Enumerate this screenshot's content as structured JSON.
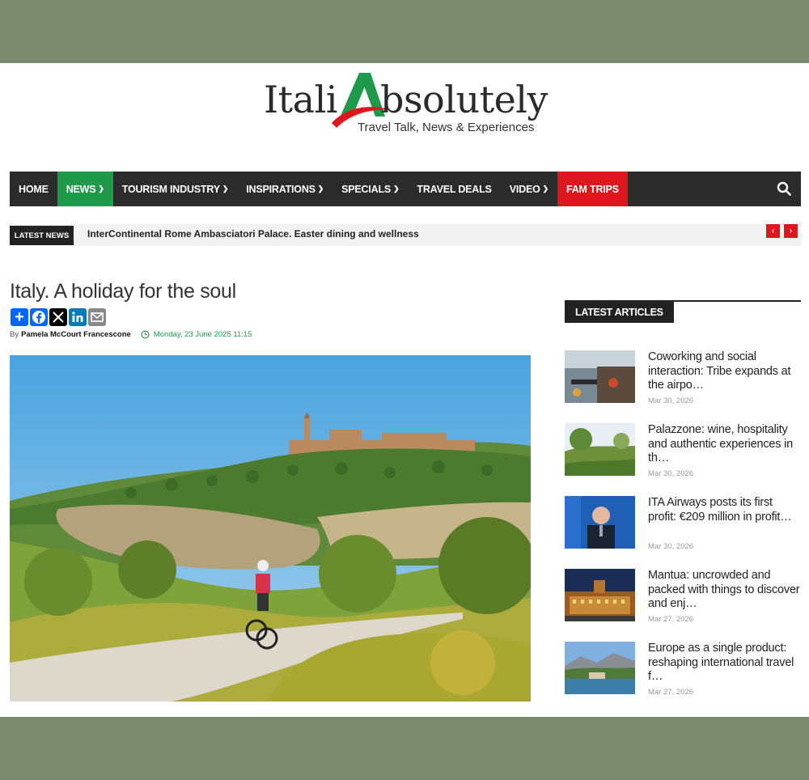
{
  "brand": {
    "logo_part1": "Itali",
    "logo_part2": "bsolutely",
    "tagline": "Travel Talk, News & Experiences",
    "colors": {
      "green": "#1f9a4b",
      "red": "#e0161f",
      "dark": "#2b2b2b"
    }
  },
  "nav": {
    "items": [
      {
        "label": "HOME",
        "has_dropdown": false
      },
      {
        "label": "NEWS",
        "has_dropdown": true,
        "active": true
      },
      {
        "label": "TOURISM INDUSTRY",
        "has_dropdown": true
      },
      {
        "label": "INSPIRATIONS",
        "has_dropdown": true
      },
      {
        "label": "SPECIALS",
        "has_dropdown": true
      },
      {
        "label": "TRAVEL DEALS",
        "has_dropdown": false
      },
      {
        "label": "VIDEO",
        "has_dropdown": true
      },
      {
        "label": "FAM TRIPS",
        "has_dropdown": false,
        "highlight": true
      }
    ],
    "search_icon": "search-icon"
  },
  "ticker": {
    "label": "LATEST NEWS",
    "headline": "InterContinental Rome Ambasciatori Palace. Easter dining and wellness",
    "prev_icon": "‹",
    "next_icon": "›"
  },
  "article": {
    "title": "Italy. A holiday for the soul",
    "by_prefix": "By",
    "author": "Pamela McCourt Francescone",
    "date": "Monday, 23 June 2025 11:15",
    "share_icons": [
      "add-icon",
      "facebook-icon",
      "x-icon",
      "linkedin-icon",
      "email-icon"
    ]
  },
  "sidebar": {
    "heading": "LATEST ARTICLES",
    "articles": [
      {
        "title": "Coworking and social interaction: Tribe expands at the airpo…",
        "date": "Mar 30, 2026"
      },
      {
        "title": "Palazzone: wine, hospitality and authentic experiences in th…",
        "date": "Mar 30, 2026"
      },
      {
        "title": "ITA Airways posts its first profit: €209 million in profit…",
        "date": "Mar 30, 2026"
      },
      {
        "title": "Mantua: uncrowded and packed with things to discover and enj…",
        "date": "Mar 27, 2026"
      },
      {
        "title": "Europe as a single product: reshaping international travel f…",
        "date": "Mar 27, 2026"
      }
    ]
  }
}
